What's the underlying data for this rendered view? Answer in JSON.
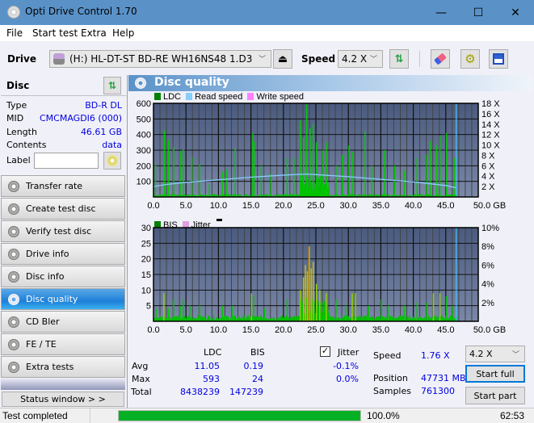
{
  "window": {
    "title": "Opti Drive Control 1.70",
    "minimize": "—",
    "maximize": "☐",
    "close": "✕"
  },
  "menu": [
    "File",
    "Start test",
    "Extra",
    "Help"
  ],
  "toolbar": {
    "drive_label": "Drive",
    "drive_value": "(H:)  HL-DT-ST BD-RE  WH16NS48 1.D3",
    "speed_label": "Speed",
    "speed_value": "4.2 X"
  },
  "disc": {
    "header": "Disc",
    "type_label": "Type",
    "type_value": "BD-R DL",
    "mid_label": "MID",
    "mid_value": "CMCMAGDI6 (000)",
    "length_label": "Length",
    "length_value": "46.61 GB",
    "contents_label": "Contents",
    "contents_value": "data",
    "label_label": "Label",
    "label_value": ""
  },
  "nav": [
    {
      "label": "Transfer rate"
    },
    {
      "label": "Create test disc"
    },
    {
      "label": "Verify test disc"
    },
    {
      "label": "Drive info"
    },
    {
      "label": "Disc info"
    },
    {
      "label": "Disc quality",
      "active": true
    },
    {
      "label": "CD Bler"
    },
    {
      "label": "FE / TE"
    },
    {
      "label": "Extra tests"
    }
  ],
  "status_window_button": "Status window > >",
  "panel_title": "Disc quality",
  "chart_data": [
    {
      "type": "bar",
      "title": "LDC",
      "legend": [
        "LDC",
        "Read speed",
        "Write speed"
      ],
      "legend_colors": {
        "LDC": "#008000",
        "Read speed": "#87cefa",
        "Write speed": "#ff80ff"
      },
      "xlabel": "GB",
      "xlim": [
        0,
        50
      ],
      "x_ticks": [
        "0.0",
        "5.0",
        "10.0",
        "15.0",
        "20.0",
        "25.0",
        "30.0",
        "35.0",
        "40.0",
        "45.0",
        "50.0 GB"
      ],
      "ylim_left": [
        0,
        600
      ],
      "y_ticks_left": [
        "100",
        "200",
        "300",
        "400",
        "500",
        "600"
      ],
      "ylim_right": [
        0,
        18
      ],
      "y_ticks_right": [
        "2 X",
        "4 X",
        "6 X",
        "8 X",
        "10 X",
        "12 X",
        "14 X",
        "16 X",
        "18 X"
      ],
      "end_marker_gb": 46.61,
      "ldc_peaks": [
        [
          0.2,
          210
        ],
        [
          1.6,
          425
        ],
        [
          2.2,
          365
        ],
        [
          3.0,
          320
        ],
        [
          4.0,
          295
        ],
        [
          4.5,
          305
        ],
        [
          5.8,
          255
        ],
        [
          7.0,
          210
        ],
        [
          8.5,
          80
        ],
        [
          10.5,
          160
        ],
        [
          11.2,
          175
        ],
        [
          12.5,
          310
        ],
        [
          15.2,
          410
        ],
        [
          15.4,
          355
        ],
        [
          16.5,
          200
        ],
        [
          18.0,
          150
        ],
        [
          20.5,
          250
        ],
        [
          21.5,
          250
        ],
        [
          22.5,
          490
        ],
        [
          23.0,
          380
        ],
        [
          23.5,
          593
        ],
        [
          24.0,
          440
        ],
        [
          24.5,
          470
        ],
        [
          25.0,
          350
        ],
        [
          26.0,
          300
        ],
        [
          26.5,
          350
        ],
        [
          28.0,
          200
        ],
        [
          29.0,
          270
        ],
        [
          30.0,
          330
        ],
        [
          30.5,
          290
        ],
        [
          32.5,
          420
        ],
        [
          33.5,
          200
        ],
        [
          35.5,
          300
        ],
        [
          37.0,
          200
        ],
        [
          38.5,
          170
        ],
        [
          40.5,
          250
        ],
        [
          42.0,
          270
        ],
        [
          42.5,
          360
        ],
        [
          43.5,
          330
        ],
        [
          44.0,
          390
        ],
        [
          45.0,
          410
        ],
        [
          46.2,
          250
        ]
      ],
      "read_speed_x": [
        0,
        2,
        5,
        10,
        15,
        20,
        23.5,
        25,
        30,
        35,
        40,
        45,
        46.6
      ],
      "read_speed_y": [
        2.0,
        2.4,
        2.8,
        3.3,
        3.8,
        4.2,
        4.4,
        4.3,
        3.9,
        3.4,
        2.9,
        2.2,
        1.76
      ]
    },
    {
      "type": "bar",
      "title": "BIS",
      "legend": [
        "BIS",
        "Jitter"
      ],
      "legend_colors": {
        "BIS": "#008000",
        "Jitter": "#e0a0e0"
      },
      "xlabel": "GB",
      "xlim": [
        0,
        50
      ],
      "x_ticks": [
        "0.0",
        "5.0",
        "10.0",
        "15.0",
        "20.0",
        "25.0",
        "30.0",
        "35.0",
        "40.0",
        "45.0",
        "50.0 GB"
      ],
      "ylim_left": [
        0,
        30
      ],
      "y_ticks_left": [
        "5",
        "10",
        "15",
        "20",
        "25",
        "30"
      ],
      "ylim_right": [
        0,
        10
      ],
      "y_ticks_right": [
        "2%",
        "4%",
        "6%",
        "8%",
        "10%"
      ],
      "end_marker_gb": 46.61,
      "bis_peaks": [
        [
          0.3,
          4
        ],
        [
          1.5,
          9
        ],
        [
          2.2,
          4
        ],
        [
          3.0,
          7
        ],
        [
          4.0,
          5
        ],
        [
          4.5,
          7
        ],
        [
          5.5,
          5
        ],
        [
          7.0,
          5
        ],
        [
          10.5,
          5
        ],
        [
          12.0,
          5
        ],
        [
          15.0,
          9
        ],
        [
          15.3,
          8
        ],
        [
          17.0,
          4
        ],
        [
          20.5,
          7
        ],
        [
          22.5,
          10
        ],
        [
          23.0,
          14
        ],
        [
          23.3,
          18
        ],
        [
          23.6,
          16
        ],
        [
          23.9,
          24
        ],
        [
          24.2,
          17
        ],
        [
          24.5,
          19
        ],
        [
          25.0,
          12
        ],
        [
          25.5,
          10
        ],
        [
          26.5,
          9
        ],
        [
          28.0,
          7
        ],
        [
          29.5,
          5
        ],
        [
          30.5,
          9
        ],
        [
          31.0,
          9
        ],
        [
          33.0,
          5
        ],
        [
          35.0,
          7
        ],
        [
          36.0,
          5
        ],
        [
          38.5,
          5
        ],
        [
          40.5,
          6
        ],
        [
          42.0,
          6
        ],
        [
          43.0,
          9
        ],
        [
          44.0,
          9
        ],
        [
          45.0,
          8
        ],
        [
          46.0,
          5
        ]
      ]
    }
  ],
  "stats": {
    "col_ldc": "LDC",
    "col_bis": "BIS",
    "avg_label": "Avg",
    "avg_ldc": "11.05",
    "avg_bis": "0.19",
    "max_label": "Max",
    "max_ldc": "593",
    "max_bis": "24",
    "total_label": "Total",
    "total_ldc": "8438239",
    "total_bis": "147239",
    "jitter_label": "Jitter",
    "jitter_checked": true,
    "jitter_avg": "-0.1%",
    "jitter_max": "0.0%",
    "speed_label": "Speed",
    "speed_value": "1.76 X",
    "position_label": "Position",
    "position_value": "47731 MB",
    "samples_label": "Samples",
    "samples_value": "761300",
    "speed_select": "4.2 X",
    "start_full": "Start full",
    "start_part": "Start part"
  },
  "status": {
    "text": "Test completed",
    "progress": 100.0,
    "progress_text": "100.0%",
    "time": "62:53"
  }
}
